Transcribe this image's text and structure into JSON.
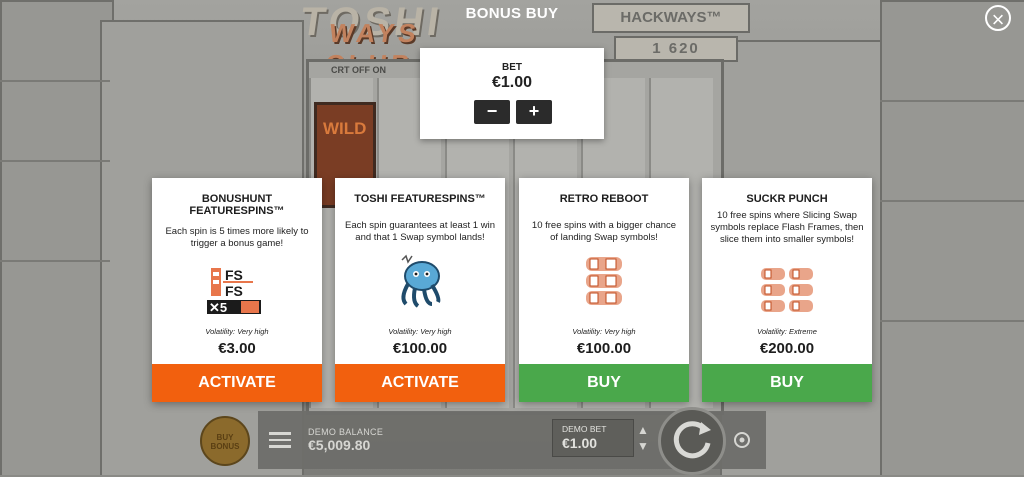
{
  "background": {
    "logo_text": "TOSHI",
    "logo_sub": "WAYS CLUB",
    "crt_label": "CRT OFF ON",
    "hackways_label": "HACKWAYS™",
    "hackways_value": "1 620"
  },
  "overlay": {
    "title": "BONUS BUY",
    "close_icon": "close-icon"
  },
  "bet": {
    "label": "BET",
    "value": "€1.00",
    "minus": "−",
    "plus": "+"
  },
  "cards": [
    {
      "title": "BONUSHUNT FEATURESPINS™",
      "description": "Each spin is 5 times more likely to trigger a bonus game!",
      "icon": "fs-x5-icon",
      "volatility": "Volatility: Very high",
      "price": "€3.00",
      "button": "ACTIVATE",
      "button_color": "#f2600e"
    },
    {
      "title": "TOSHI FEATURESPINS™",
      "description": "Each spin guarantees at least 1 win and that 1 Swap symbol lands!",
      "icon": "octopus-icon",
      "volatility": "Volatility: Very high",
      "price": "€100.00",
      "button": "ACTIVATE",
      "button_color": "#f2600e"
    },
    {
      "title": "RETRO REBOOT",
      "description": "10 free spins with a bigger chance of landing Swap symbols!",
      "icon": "swap-symbols-icon",
      "volatility": "Volatility: Very high",
      "price": "€100.00",
      "button": "BUY",
      "button_color": "#4aa84b"
    },
    {
      "title": "SUCKR PUNCH",
      "description": "10 free spins where Slicing Swap symbols replace Flash Frames, then slice them into smaller symbols!",
      "icon": "sliced-symbols-icon",
      "volatility": "Volatility: Extreme",
      "price": "€200.00",
      "button": "BUY",
      "button_color": "#4aa84b"
    }
  ],
  "bottom_bar": {
    "buy_bonus_label": "BUY BONUS",
    "balance_label": "DEMO BALANCE",
    "balance_value": "€5,009.80",
    "bet_label": "DEMO BET",
    "bet_value": "€1.00"
  }
}
